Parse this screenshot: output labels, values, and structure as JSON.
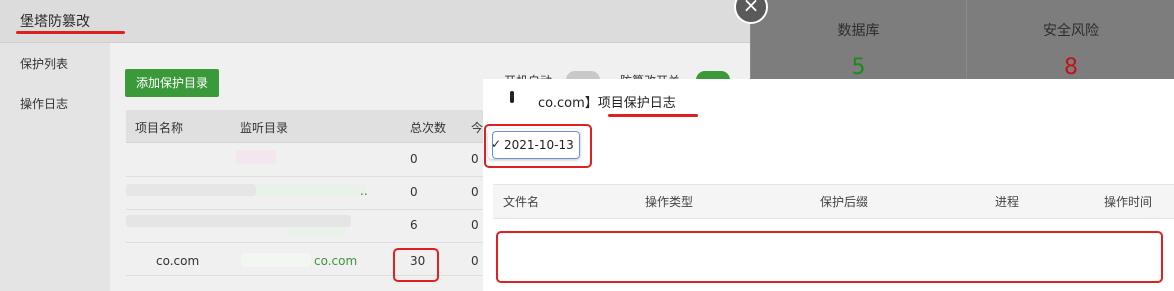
{
  "dialog": {
    "title": "堡塔防篡改",
    "sidebar": {
      "items": [
        {
          "label": "保护列表"
        },
        {
          "label": "操作日志"
        }
      ]
    },
    "toolbar": {
      "add_label": "添加保护目录",
      "toggle1_label": "开机自动",
      "toggle2_label": "防篡改开关"
    },
    "table": {
      "headers": [
        "项目名称",
        "监听目录",
        "总次数",
        "今"
      ],
      "rows": [
        {
          "name": "",
          "dir": "",
          "total": "0",
          "today": "0"
        },
        {
          "name": "",
          "dir": "..",
          "total": "0",
          "today": "0"
        },
        {
          "name": "",
          "dir": "",
          "total": "6",
          "today": "0"
        },
        {
          "name": "co.com",
          "dir": "co.com",
          "total": "30",
          "today": "0"
        }
      ]
    }
  },
  "stats": [
    {
      "title": "数据库",
      "value": "5",
      "color": "#1e8a1e"
    },
    {
      "title": "安全风险",
      "value": "8",
      "color": "#c0141c"
    }
  ],
  "log_panel": {
    "title": "co.com】项目保护日志",
    "date_selected": "2021-10-13",
    "check_mark": "✓",
    "columns": [
      "文件名",
      "操作类型",
      "保护后缀",
      "进程",
      "操作时间"
    ]
  },
  "colors": {
    "highlight_red": "#e02020",
    "accent_green": "#3a9a3a"
  }
}
